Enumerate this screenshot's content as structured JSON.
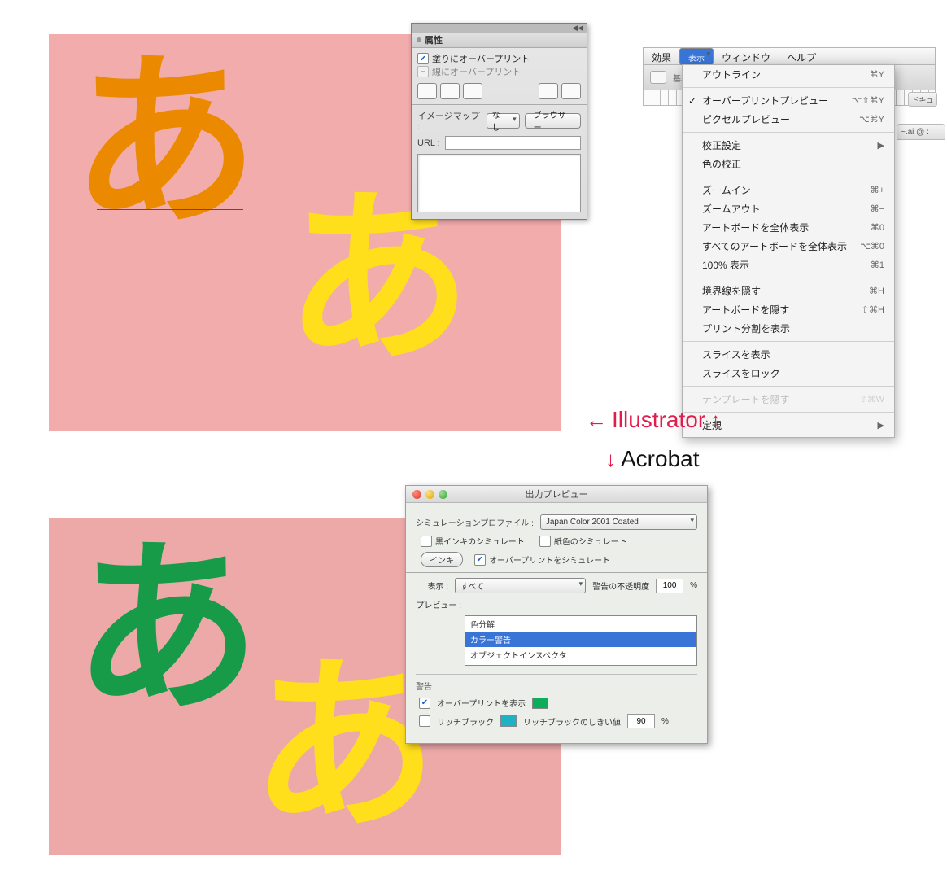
{
  "glyph_char": "あ",
  "attributes_panel": {
    "title": "属性",
    "fill_overprint": "塗りにオーバープリント",
    "stroke_overprint": "線にオーバープリント",
    "image_map_label": "イメージマップ :",
    "image_map_value": "なし",
    "browser_btn": "ブラウザー",
    "url_label": "URL :"
  },
  "menubar": {
    "effects": "効果",
    "view": "表示",
    "window": "ウィンドウ",
    "help": "ヘルプ"
  },
  "side_labels": {
    "basic": "基本",
    "doc": "ドキュ"
  },
  "doc_tab": "~.ai @ :",
  "view_menu": {
    "outline": {
      "label": "アウトライン",
      "sc": "⌘Y"
    },
    "overprint_preview": {
      "label": "オーバープリントプレビュー",
      "sc": "⌥⇧⌘Y"
    },
    "pixel_preview": {
      "label": "ピクセルプレビュー",
      "sc": "⌥⌘Y"
    },
    "proof_setup": {
      "label": "校正設定",
      "sc": "▶"
    },
    "proof_colors": {
      "label": "色の校正",
      "sc": ""
    },
    "zoom_in": {
      "label": "ズームイン",
      "sc": "⌘+"
    },
    "zoom_out": {
      "label": "ズームアウト",
      "sc": "⌘−"
    },
    "fit_artboard": {
      "label": "アートボードを全体表示",
      "sc": "⌘0"
    },
    "fit_all": {
      "label": "すべてのアートボードを全体表示",
      "sc": "⌥⌘0"
    },
    "actual_size": {
      "label": "100% 表示",
      "sc": "⌘1"
    },
    "hide_edges": {
      "label": "境界線を隠す",
      "sc": "⌘H"
    },
    "hide_artboards": {
      "label": "アートボードを隠す",
      "sc": "⇧⌘H"
    },
    "show_print_tiling": {
      "label": "プリント分割を表示",
      "sc": ""
    },
    "show_slices": {
      "label": "スライスを表示",
      "sc": ""
    },
    "lock_slices": {
      "label": "スライスをロック",
      "sc": ""
    },
    "hide_template": {
      "label": "テンプレートを隠す",
      "sc": "⇧⌘W"
    },
    "ruler": {
      "label": "定規",
      "sc": "▶"
    }
  },
  "annotation": {
    "illustrator": "Illustrator",
    "acrobat": "Acrobat"
  },
  "acrobat_dialog": {
    "title": "出力プレビュー",
    "sim_profile_label": "シミュレーションプロファイル :",
    "sim_profile_value": "Japan Color 2001 Coated",
    "sim_black_ink": "黒インキのシミュレート",
    "sim_paper": "紙色のシミュレート",
    "ink_btn": "インキ",
    "sim_overprint": "オーバープリントをシミュレート",
    "show_label": "表示 :",
    "show_value": "すべて",
    "warn_opacity_label": "警告の不透明度",
    "warn_opacity_value": "100",
    "percent": "%",
    "preview_label": "プレビュー :",
    "preview_opts": [
      "色分解",
      "カラー警告",
      "オブジェクトインスペクタ"
    ],
    "warnings_heading": "警告",
    "show_overprint_chk": "オーバープリントを表示",
    "rich_black_chk": "リッチブラック",
    "rich_black_thresh_label": "リッチブラックのしきい値",
    "rich_black_thresh_value": "90"
  }
}
